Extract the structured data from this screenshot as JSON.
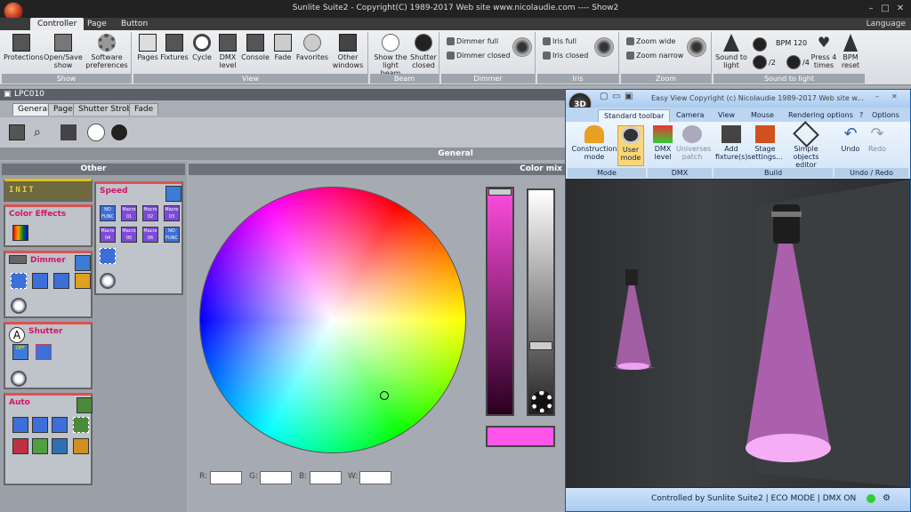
{
  "window": {
    "title": "Sunlite Suite2 - Copyright(C) 1989-2017    Web site www.nicolaudie.com ---- Show2"
  },
  "menu": {
    "tabs": [
      "Controller",
      "Page",
      "Button"
    ],
    "language": "Language"
  },
  "ribbon": {
    "groups": {
      "show": "Show",
      "view": "View",
      "beam": "Beam",
      "dimmer": "Dimmer",
      "iris": "Iris",
      "zoom": "Zoom",
      "sound": "Sound to light"
    },
    "show": [
      "Protections",
      "Open/Save show",
      "Software preferences"
    ],
    "view": [
      "Pages",
      "Fixtures",
      "Cycle",
      "DMX level",
      "Console",
      "Fade",
      "Favorites",
      "Other windows"
    ],
    "beam": [
      "Show the light beam",
      "Shutter closed"
    ],
    "dimmer": [
      "Dimmer full",
      "Dimmer closed"
    ],
    "iris": [
      "Iris full",
      "Iris closed"
    ],
    "zoom": [
      "Zoom wide",
      "Zoom narrow"
    ],
    "sound": {
      "sound_to_light": "Sound to light",
      "bpm": "BPM 120",
      "div2": "/2",
      "div4": "/4",
      "press4": "Press 4 times",
      "bpm_reset": "BPM reset"
    }
  },
  "device": {
    "name": "LPC010"
  },
  "subtabs": [
    "General",
    "Page",
    "Shutter Strobe",
    "Fade"
  ],
  "general_label": "General",
  "other": {
    "title": "Other",
    "cards": {
      "init": "INIT",
      "color_effects": "Color Effects",
      "dimmer": "Dimmer",
      "shutter": "Shutter",
      "auto": "Auto",
      "speed": "Speed"
    },
    "macros": [
      "NO FUNC",
      "Macro 01",
      "Macro 02",
      "Macro 03",
      "Macro 04",
      "Macro 05",
      "Macro 06",
      "NO FUNC"
    ],
    "shutter_off": "OFF"
  },
  "color_mix": {
    "title": "Color mix",
    "labels": [
      "R:",
      "G:",
      "B:",
      "W:"
    ],
    "swatch_color": "#ff55e8"
  },
  "easyview": {
    "title": "Easy View   Copyright (c) Nicolaudie 1989-2017   Web site w...",
    "logo": "3D",
    "tabs": [
      "Standard toolbar",
      "Camera",
      "View",
      "Mouse",
      "Rendering options"
    ],
    "help": "?",
    "options": "Options",
    "buttons": [
      "Construction mode",
      "User mode",
      "DMX level",
      "Universes patch",
      "Add fixture(s)",
      "Stage settings...",
      "Simple objects editor",
      "Undo",
      "Redo"
    ],
    "groups": [
      "Mode",
      "DMX",
      "Build",
      "Undo / Redo"
    ],
    "status": "Controlled by Sunlite Suite2  |  ECO MODE  |  DMX ON"
  }
}
